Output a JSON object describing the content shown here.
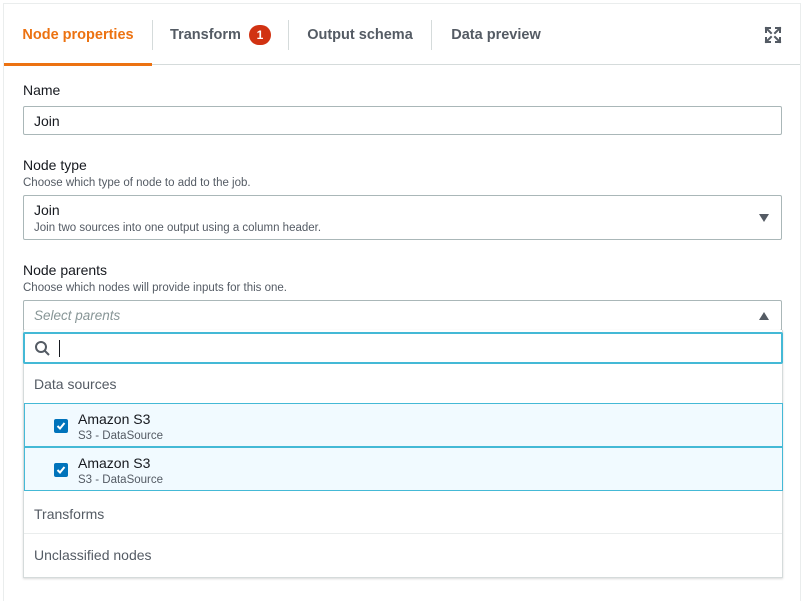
{
  "tabs": [
    {
      "label": "Node properties",
      "active": true
    },
    {
      "label": "Transform",
      "badge": "1"
    },
    {
      "label": "Output schema"
    },
    {
      "label": "Data preview"
    }
  ],
  "icons": {
    "expand": "expand-icon",
    "search": "search-icon",
    "check": "checkmark-icon"
  },
  "colors": {
    "accent": "#ec7211",
    "badge": "#d13212",
    "focus": "#44b9d6",
    "checkbox": "#0073bb",
    "selected_bg": "#f1faff"
  },
  "name_field": {
    "label": "Name",
    "value": "Join"
  },
  "node_type": {
    "label": "Node type",
    "description": "Choose which type of node to add to the job.",
    "value": "Join",
    "value_description": "Join two sources into one output using a column header."
  },
  "node_parents": {
    "label": "Node parents",
    "description": "Choose which nodes will provide inputs for this one.",
    "placeholder": "Select parents",
    "search_value": "",
    "groups": [
      {
        "label": "Data sources",
        "options": [
          {
            "title": "Amazon S3",
            "subtitle": "S3 - DataSource",
            "checked": true
          },
          {
            "title": "Amazon S3",
            "subtitle": "S3 - DataSource",
            "checked": true
          }
        ]
      },
      {
        "label": "Transforms"
      },
      {
        "label": "Unclassified nodes"
      }
    ]
  }
}
